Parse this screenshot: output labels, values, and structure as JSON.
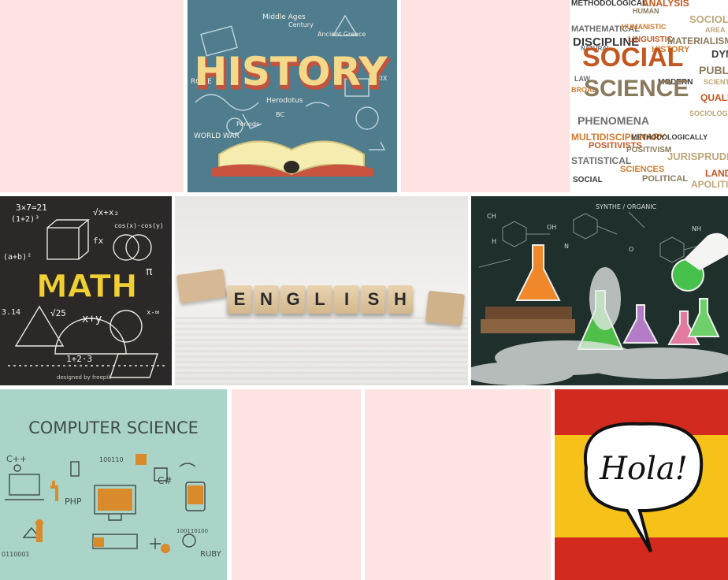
{
  "tiles": {
    "history": {
      "title": "HISTORY",
      "notes": [
        "Middle Ages",
        "Century",
        "Ancient Greece",
        "ROME",
        "Herodotus",
        "BC",
        "Periods",
        "WORLD WAR",
        "XIX"
      ]
    },
    "social_science": {
      "words": [
        "METHODOLOGICAL",
        "ANALYSIS",
        "HUMAN",
        "SOCIOLOGY",
        "MATHEMATICAL",
        "HUMANISTIC",
        "DISCIPLINE",
        "LINGUISTIC",
        "MATERIALISM",
        "AREA",
        "NATURAL",
        "HISTORY",
        "DYNAMIC",
        "SOCIAL",
        "PUBLIC",
        "SCIENTISTS",
        "LAW",
        "BROAD",
        "MODERN",
        "QUALITATIVE",
        "SCIENCE",
        "SOCIOLOGICAL",
        "PHENOMENA",
        "MULTIDISCIPLINARY",
        "METHODOLOGICALLY",
        "POSITIVISTS",
        "POSITIVISM",
        "JURISPRUDENCE",
        "STATISTICAL",
        "SCIENCES",
        "SOCIAL",
        "LAND",
        "POLITICAL",
        "APOLITICAL"
      ]
    },
    "math": {
      "title": "MATH",
      "formulas": [
        "3×7=21",
        "(1+2)³",
        "√x+x₂",
        "(a+b)²",
        "cos(x)·cos(y)",
        "fx",
        "π",
        "√25",
        "x+y",
        "1+2·3",
        "3.14",
        "x-∞"
      ],
      "credit": "designed by freepik"
    },
    "english": {
      "letters": [
        "E",
        "N",
        "G",
        "L",
        "I",
        "S",
        "H"
      ]
    },
    "chemistry": {
      "notes": [
        "SYNTHE / ORGANIC",
        "CH",
        "OH",
        "NH",
        "H",
        "O",
        "N"
      ]
    },
    "computer_science": {
      "title": "COMPUTER SCIENCE",
      "labels": [
        "C++",
        "100110",
        "C#",
        "PHP",
        "RUBY",
        "100110100",
        "0110001"
      ]
    },
    "spanish": {
      "greeting": "Hola!"
    }
  },
  "colors": {
    "pink": "#fde3e1",
    "history_bg": "#4f7d8e",
    "history_title": "#f4d98b",
    "math_bg": "#2b2827",
    "math_title": "#f0cf33",
    "cs_bg": "#a9d4c7",
    "spain_red": "#d22a1f",
    "spain_yellow": "#f6c21a"
  }
}
